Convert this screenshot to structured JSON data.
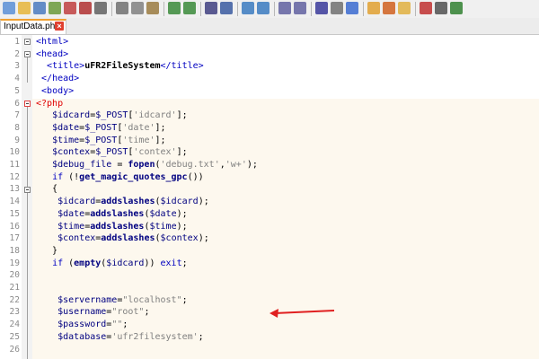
{
  "toolbar": {
    "icons": [
      "new-file-icon",
      "open-icon",
      "save-icon",
      "save-all-icon",
      "close-icon",
      "close-all-icon",
      "print-icon",
      "cut-icon",
      "copy-icon",
      "paste-icon",
      "undo-icon",
      "redo-icon",
      "find-icon",
      "replace-icon",
      "zoom-in-icon",
      "zoom-out-icon",
      "sync-v-icon",
      "sync-h-icon",
      "word-wrap-icon",
      "all-chars-icon",
      "indent-guide-icon",
      "doc-map-icon",
      "function-list-icon",
      "folder-icon",
      "record-icon",
      "stop-icon",
      "play-icon"
    ]
  },
  "tab": {
    "label": "InputData.php",
    "close": "×"
  },
  "lines": [
    {
      "n": "1",
      "html": "<span class=\"tag\">&lt;html&gt;</span>"
    },
    {
      "n": "2",
      "html": "<span class=\"tag\">&lt;head&gt;</span>"
    },
    {
      "n": "3",
      "html": "  <span class=\"tag\">&lt;title&gt;</span><b>uFR2FileSystem</b><span class=\"tag\">&lt;/title&gt;</span>"
    },
    {
      "n": "4",
      "html": " <span class=\"tag\">&lt;/head&gt;</span>"
    },
    {
      "n": "5",
      "html": " <span class=\"tag\">&lt;body&gt;</span>"
    },
    {
      "n": "6",
      "html": "<span class=\"phptag\">&lt;?php</span>"
    },
    {
      "n": "7",
      "html": "   <span class=\"var\">$idcard</span>=<span class=\"var\">$_POST</span>[<span class=\"str\">'idcard'</span>];"
    },
    {
      "n": "8",
      "html": "   <span class=\"var\">$date</span>=<span class=\"var\">$_POST</span>[<span class=\"str\">'date'</span>];"
    },
    {
      "n": "9",
      "html": "   <span class=\"var\">$time</span>=<span class=\"var\">$_POST</span>[<span class=\"str\">'time'</span>];"
    },
    {
      "n": "10",
      "html": "   <span class=\"var\">$contex</span>=<span class=\"var\">$_POST</span>[<span class=\"str\">'contex'</span>];"
    },
    {
      "n": "11",
      "html": "   <span class=\"var\">$debug_file</span> = <span class=\"fn\">fopen</span>(<span class=\"str\">'debug.txt'</span>,<span class=\"str\">'w+'</span>);"
    },
    {
      "n": "12",
      "html": "   <span class=\"kw\">if</span> (!<span class=\"fn\">get_magic_quotes_gpc</span>())"
    },
    {
      "n": "13",
      "html": "   {"
    },
    {
      "n": "14",
      "html": "    <span class=\"var\">$idcard</span>=<span class=\"fn\">addslashes</span>(<span class=\"var\">$idcard</span>);"
    },
    {
      "n": "15",
      "html": "    <span class=\"var\">$date</span>=<span class=\"fn\">addslashes</span>(<span class=\"var\">$date</span>);"
    },
    {
      "n": "16",
      "html": "    <span class=\"var\">$time</span>=<span class=\"fn\">addslashes</span>(<span class=\"var\">$time</span>);"
    },
    {
      "n": "17",
      "html": "    <span class=\"var\">$contex</span>=<span class=\"fn\">addslashes</span>(<span class=\"var\">$contex</span>);"
    },
    {
      "n": "18",
      "html": "   }"
    },
    {
      "n": "19",
      "html": "   <span class=\"kw\">if</span> (<span class=\"fn\">empty</span>(<span class=\"var\">$idcard</span>)) <span class=\"kw\">exit</span>;"
    },
    {
      "n": "20",
      "html": ""
    },
    {
      "n": "21",
      "html": ""
    },
    {
      "n": "22",
      "html": "    <span class=\"var\">$servername</span>=<span class=\"str\">\"localhost\"</span>;"
    },
    {
      "n": "23",
      "html": "    <span class=\"var\">$username</span>=<span class=\"str\">\"root\"</span>;"
    },
    {
      "n": "24",
      "html": "    <span class=\"var\">$password</span>=<span class=\"str\">\"\"</span>;"
    },
    {
      "n": "25",
      "html": "    <span class=\"var\">$database</span>=<span class=\"str\">'ufr2filesystem'</span>;"
    },
    {
      "n": "26",
      "html": ""
    }
  ],
  "annotation": {
    "color": "#e02020"
  }
}
